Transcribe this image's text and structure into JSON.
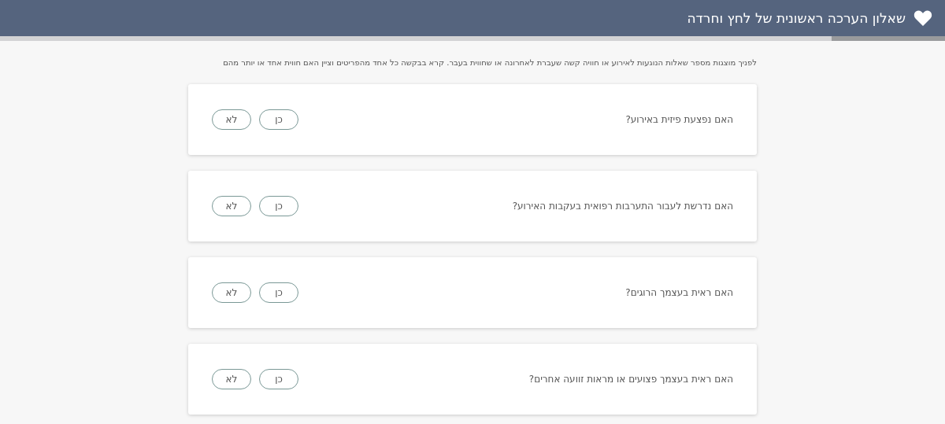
{
  "header": {
    "title": "שאלון הערכה ראשונית של לחץ וחרדה"
  },
  "progress": {
    "level": 0.12
  },
  "intro": "לפניך מוצגות מספר שאלות הנוגעות לאירוע או חוויה קשה שעברת לאחרונה או שחווית בעבר. קרא בבקשה כל אחד מהפריטים וציין האם חווית אחד או יותר מהם",
  "questions": [
    {
      "text": "האם נפצעת פיזית באירוע?",
      "answers": [
        {
          "label": "כן",
          "selected": false
        },
        {
          "label": "לא",
          "selected": false
        }
      ]
    },
    {
      "text": "האם נדרשת לעבור התערבות רפואית בעקבות האירוע?",
      "answers": [
        {
          "label": "כן",
          "selected": false
        },
        {
          "label": "לא",
          "selected": false
        }
      ]
    },
    {
      "text": "האם ראית בעצמך הרוגים?",
      "answers": [
        {
          "label": "כן",
          "selected": false
        },
        {
          "label": "לא",
          "selected": false
        }
      ]
    },
    {
      "text": "האם ראית בעצמך פצועים או מראות זוועה אחרים?",
      "answers": [
        {
          "label": "כן",
          "selected": false
        },
        {
          "label": "לא",
          "selected": false
        }
      ]
    }
  ]
}
